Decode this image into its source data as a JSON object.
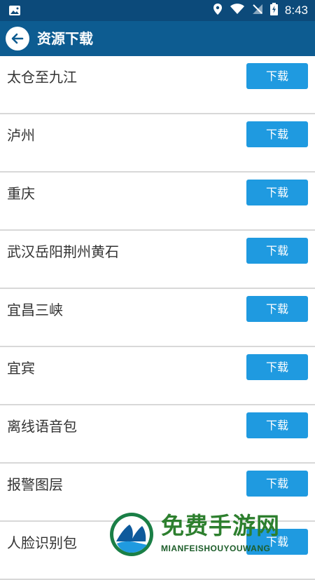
{
  "status_bar": {
    "time": "8:43",
    "icons": [
      "image-icon",
      "location-icon",
      "wifi-icon",
      "signal-off-icon",
      "battery-charging-icon"
    ],
    "background": "#0c4a7a"
  },
  "app_bar": {
    "title": "资源下载",
    "back_icon": "arrow-left-icon",
    "background": "#0d5c91"
  },
  "items": [
    {
      "label": "太仓至九江",
      "button": "下载"
    },
    {
      "label": "泸州",
      "button": "下载"
    },
    {
      "label": "重庆",
      "button": "下载"
    },
    {
      "label": "武汉岳阳荆州黄石",
      "button": "下载"
    },
    {
      "label": "宜昌三峡",
      "button": "下载"
    },
    {
      "label": "宜宾",
      "button": "下载"
    },
    {
      "label": "离线语音包",
      "button": "下载"
    },
    {
      "label": "报警图层",
      "button": "下载"
    },
    {
      "label": "人脸识别包",
      "button": "下载"
    }
  ],
  "colors": {
    "button": "#1f9ae0",
    "divider": "#d8d8d8",
    "text": "#333333"
  },
  "watermark": {
    "title": "免费手游网",
    "subtitle": "MIANFEISHOUYOUWANG"
  }
}
